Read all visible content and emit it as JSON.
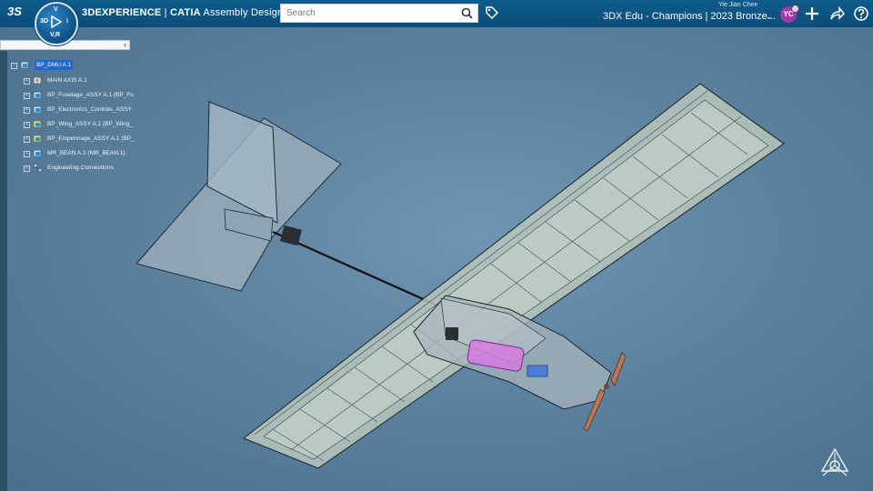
{
  "header": {
    "ds_logo": "3S",
    "brand": "3DEXPERIENCE",
    "separator": " | ",
    "app": "CATIA",
    "app_module": "Assembly Design",
    "search_placeholder": "Search",
    "user_name": "Yie Jian Chee",
    "platform_title": "3DX Edu - Champions | 2023 Bronze...",
    "avatar_initials": "YC"
  },
  "compass": {
    "top": "V",
    "left": "3D",
    "right": "i",
    "bottom": "V,R"
  },
  "tree": {
    "root": "BP_DMU A.1",
    "items": [
      "MAIN AXIS A.1",
      "BP_Fuselage_ASSY A.1 (BP_Fu",
      "BP_Electronics_Controls_ASSY",
      "BP_Wing_ASSY A.1 (BP_Wing_",
      "BP_Empennage_ASSY A.1 (BP_",
      "MR_BEAN A.1 (MR_BEAN.1)",
      "Engineering Connections"
    ]
  },
  "colors": {
    "topbar": "#0a4d78",
    "accent_avatar": "#a33aa8",
    "selection": "#2166d1",
    "background": "#5b7f9c"
  }
}
